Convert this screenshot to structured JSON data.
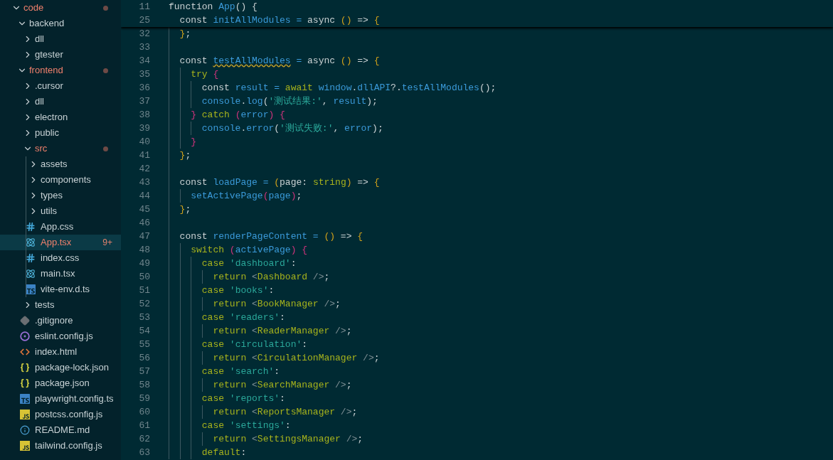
{
  "explorer": {
    "items": [
      {
        "kind": "folder",
        "name": "code",
        "expanded": true,
        "modified": true,
        "selected": false,
        "children": [
          {
            "kind": "folder",
            "name": "backend",
            "expanded": true,
            "modified": false,
            "selected": false,
            "children": [
              {
                "kind": "folder",
                "name": "dll",
                "expanded": false,
                "modified": false,
                "selected": false
              },
              {
                "kind": "folder",
                "name": "gtester",
                "expanded": false,
                "modified": false,
                "selected": false
              }
            ]
          },
          {
            "kind": "folder",
            "name": "frontend",
            "expanded": true,
            "modified": true,
            "selected": false,
            "children": [
              {
                "kind": "folder",
                "name": ".cursor",
                "expanded": false,
                "modified": false,
                "selected": false
              },
              {
                "kind": "folder",
                "name": "dll",
                "expanded": false,
                "modified": false,
                "selected": false
              },
              {
                "kind": "folder",
                "name": "electron",
                "expanded": false,
                "modified": false,
                "selected": false
              },
              {
                "kind": "folder",
                "name": "public",
                "expanded": false,
                "modified": false,
                "selected": false
              },
              {
                "kind": "folder",
                "name": "src",
                "expanded": true,
                "modified": true,
                "selected": false,
                "children": [
                  {
                    "kind": "folder",
                    "name": "assets",
                    "expanded": false,
                    "modified": false,
                    "selected": false
                  },
                  {
                    "kind": "folder",
                    "name": "components",
                    "expanded": false,
                    "modified": false,
                    "selected": false
                  },
                  {
                    "kind": "folder",
                    "name": "types",
                    "expanded": false,
                    "modified": false,
                    "selected": false
                  },
                  {
                    "kind": "folder",
                    "name": "utils",
                    "expanded": false,
                    "modified": false,
                    "selected": false
                  },
                  {
                    "kind": "css",
                    "name": "App.css",
                    "modified": false,
                    "selected": false
                  },
                  {
                    "kind": "react",
                    "name": "App.tsx",
                    "modified": true,
                    "selected": true,
                    "badge": "9+"
                  },
                  {
                    "kind": "css",
                    "name": "index.css",
                    "modified": false,
                    "selected": false
                  },
                  {
                    "kind": "react",
                    "name": "main.tsx",
                    "modified": false,
                    "selected": false
                  },
                  {
                    "kind": "ts",
                    "name": "vite-env.d.ts",
                    "modified": false,
                    "selected": false
                  }
                ]
              },
              {
                "kind": "folder",
                "name": "tests",
                "expanded": false,
                "modified": false,
                "selected": false
              },
              {
                "kind": "git",
                "name": ".gitignore",
                "modified": false,
                "selected": false
              },
              {
                "kind": "eslint",
                "name": "eslint.config.js",
                "modified": false,
                "selected": false
              },
              {
                "kind": "html",
                "name": "index.html",
                "modified": false,
                "selected": false
              },
              {
                "kind": "json",
                "name": "package-lock.json",
                "modified": false,
                "selected": false
              },
              {
                "kind": "json",
                "name": "package.json",
                "modified": false,
                "selected": false
              },
              {
                "kind": "ts",
                "name": "playwright.config.ts",
                "modified": false,
                "selected": false
              },
              {
                "kind": "js",
                "name": "postcss.config.js",
                "modified": false,
                "selected": false
              },
              {
                "kind": "info",
                "name": "README.md",
                "modified": false,
                "selected": false
              },
              {
                "kind": "js",
                "name": "tailwind.config.js",
                "modified": false,
                "selected": false
              }
            ]
          }
        ]
      }
    ]
  },
  "editor": {
    "sticky_lines": [
      {
        "number": "11",
        "tokens": [
          {
            "kind": "kw",
            "text": "function "
          },
          {
            "kind": "fn",
            "text": "App"
          },
          {
            "kind": "pl",
            "text": "() {"
          }
        ]
      },
      {
        "number": "25",
        "tokens": [
          {
            "kind": "kw",
            "text": "  const "
          },
          {
            "kind": "fn",
            "text": "initAllModules"
          },
          {
            "kind": "op",
            "text": " = "
          },
          {
            "kind": "kw",
            "text": "async "
          },
          {
            "kind": "br1",
            "text": "()"
          },
          {
            "kind": "pl",
            "text": " => "
          },
          {
            "kind": "br1",
            "text": "{"
          }
        ]
      }
    ],
    "lines": [
      {
        "number": "32",
        "tokens": [
          {
            "kind": "br1",
            "text": "  }"
          },
          {
            "kind": "pl",
            "text": ";"
          }
        ]
      },
      {
        "number": "33"
      },
      {
        "number": "34",
        "tokens": [
          {
            "kind": "kw",
            "text": "  const "
          },
          {
            "kind": "fn",
            "text": "testAllModules",
            "warning": true
          },
          {
            "kind": "op",
            "text": " = "
          },
          {
            "kind": "kw",
            "text": "async "
          },
          {
            "kind": "br1",
            "text": "()"
          },
          {
            "kind": "pl",
            "text": " => "
          },
          {
            "kind": "br1",
            "text": "{"
          }
        ]
      },
      {
        "number": "35",
        "tokens": [
          {
            "kind": "ctl",
            "text": "    try "
          },
          {
            "kind": "br2",
            "text": "{"
          }
        ]
      },
      {
        "number": "36",
        "tokens": [
          {
            "kind": "kw",
            "text": "      const "
          },
          {
            "kind": "fn",
            "text": "result"
          },
          {
            "kind": "op",
            "text": " = "
          },
          {
            "kind": "ctl",
            "text": "await "
          },
          {
            "kind": "fn",
            "text": "window"
          },
          {
            "kind": "pl",
            "text": "."
          },
          {
            "kind": "fn",
            "text": "dllAPI"
          },
          {
            "kind": "pl",
            "text": "?."
          },
          {
            "kind": "fn",
            "text": "testAllModules"
          },
          {
            "kind": "pl",
            "text": "();"
          }
        ]
      },
      {
        "number": "37",
        "tokens": [
          {
            "kind": "fn",
            "text": "      console"
          },
          {
            "kind": "pl",
            "text": "."
          },
          {
            "kind": "fn",
            "text": "log"
          },
          {
            "kind": "pl",
            "text": "("
          },
          {
            "kind": "str",
            "text": "'测试结果:'"
          },
          {
            "kind": "pl",
            "text": ", "
          },
          {
            "kind": "fn",
            "text": "result"
          },
          {
            "kind": "pl",
            "text": ");"
          }
        ]
      },
      {
        "number": "38",
        "tokens": [
          {
            "kind": "br2",
            "text": "    }"
          },
          {
            "kind": "ctl",
            "text": " catch "
          },
          {
            "kind": "br2",
            "text": "("
          },
          {
            "kind": "fn",
            "text": "error"
          },
          {
            "kind": "br2",
            "text": ") {"
          }
        ]
      },
      {
        "number": "39",
        "tokens": [
          {
            "kind": "fn",
            "text": "      console"
          },
          {
            "kind": "pl",
            "text": "."
          },
          {
            "kind": "fn",
            "text": "error"
          },
          {
            "kind": "pl",
            "text": "("
          },
          {
            "kind": "str",
            "text": "'测试失败:'"
          },
          {
            "kind": "pl",
            "text": ", "
          },
          {
            "kind": "fn",
            "text": "error"
          },
          {
            "kind": "pl",
            "text": ");"
          }
        ]
      },
      {
        "number": "40",
        "tokens": [
          {
            "kind": "br2",
            "text": "    }"
          }
        ]
      },
      {
        "number": "41",
        "tokens": [
          {
            "kind": "br1",
            "text": "  }"
          },
          {
            "kind": "pl",
            "text": ";"
          }
        ]
      },
      {
        "number": "42"
      },
      {
        "number": "43",
        "tokens": [
          {
            "kind": "kw",
            "text": "  const "
          },
          {
            "kind": "fn",
            "text": "loadPage"
          },
          {
            "kind": "op",
            "text": " = "
          },
          {
            "kind": "br1",
            "text": "("
          },
          {
            "kind": "pl",
            "text": "page: "
          },
          {
            "kind": "ctl",
            "text": "string"
          },
          {
            "kind": "br1",
            "text": ")"
          },
          {
            "kind": "pl",
            "text": " => "
          },
          {
            "kind": "br1",
            "text": "{"
          }
        ]
      },
      {
        "number": "44",
        "tokens": [
          {
            "kind": "fn",
            "text": "    setActivePage"
          },
          {
            "kind": "br2",
            "text": "("
          },
          {
            "kind": "fn",
            "text": "page"
          },
          {
            "kind": "br2",
            "text": ")"
          },
          {
            "kind": "pl",
            "text": ";"
          }
        ]
      },
      {
        "number": "45",
        "tokens": [
          {
            "kind": "br1",
            "text": "  }"
          },
          {
            "kind": "pl",
            "text": ";"
          }
        ]
      },
      {
        "number": "46"
      },
      {
        "number": "47",
        "tokens": [
          {
            "kind": "kw",
            "text": "  const "
          },
          {
            "kind": "fn",
            "text": "renderPageContent"
          },
          {
            "kind": "op",
            "text": " = "
          },
          {
            "kind": "br1",
            "text": "()"
          },
          {
            "kind": "pl",
            "text": " => "
          },
          {
            "kind": "br1",
            "text": "{"
          }
        ]
      },
      {
        "number": "48",
        "tokens": [
          {
            "kind": "ctl",
            "text": "    switch "
          },
          {
            "kind": "br2",
            "text": "("
          },
          {
            "kind": "fn",
            "text": "activePage"
          },
          {
            "kind": "br2",
            "text": ") {"
          }
        ]
      },
      {
        "number": "49",
        "tokens": [
          {
            "kind": "ctl",
            "text": "      case "
          },
          {
            "kind": "str",
            "text": "'dashboard'"
          },
          {
            "kind": "pl",
            "text": ":"
          }
        ]
      },
      {
        "number": "50",
        "tokens": [
          {
            "kind": "ctl",
            "text": "        return "
          },
          {
            "kind": "dim",
            "text": "<"
          },
          {
            "kind": "ctl",
            "text": "Dashboard"
          },
          {
            "kind": "dim",
            "text": " />"
          },
          {
            "kind": "pl",
            "text": ";"
          }
        ]
      },
      {
        "number": "51",
        "tokens": [
          {
            "kind": "ctl",
            "text": "      case "
          },
          {
            "kind": "str",
            "text": "'books'"
          },
          {
            "kind": "pl",
            "text": ":"
          }
        ]
      },
      {
        "number": "52",
        "tokens": [
          {
            "kind": "ctl",
            "text": "        return "
          },
          {
            "kind": "dim",
            "text": "<"
          },
          {
            "kind": "ctl",
            "text": "BookManager"
          },
          {
            "kind": "dim",
            "text": " />"
          },
          {
            "kind": "pl",
            "text": ";"
          }
        ]
      },
      {
        "number": "53",
        "tokens": [
          {
            "kind": "ctl",
            "text": "      case "
          },
          {
            "kind": "str",
            "text": "'readers'"
          },
          {
            "kind": "pl",
            "text": ":"
          }
        ]
      },
      {
        "number": "54",
        "tokens": [
          {
            "kind": "ctl",
            "text": "        return "
          },
          {
            "kind": "dim",
            "text": "<"
          },
          {
            "kind": "ctl",
            "text": "ReaderManager"
          },
          {
            "kind": "dim",
            "text": " />"
          },
          {
            "kind": "pl",
            "text": ";"
          }
        ]
      },
      {
        "number": "55",
        "tokens": [
          {
            "kind": "ctl",
            "text": "      case "
          },
          {
            "kind": "str",
            "text": "'circulation'"
          },
          {
            "kind": "pl",
            "text": ":"
          }
        ]
      },
      {
        "number": "56",
        "tokens": [
          {
            "kind": "ctl",
            "text": "        return "
          },
          {
            "kind": "dim",
            "text": "<"
          },
          {
            "kind": "ctl",
            "text": "CirculationManager"
          },
          {
            "kind": "dim",
            "text": " />"
          },
          {
            "kind": "pl",
            "text": ";"
          }
        ]
      },
      {
        "number": "57",
        "tokens": [
          {
            "kind": "ctl",
            "text": "      case "
          },
          {
            "kind": "str",
            "text": "'search'"
          },
          {
            "kind": "pl",
            "text": ":"
          }
        ]
      },
      {
        "number": "58",
        "tokens": [
          {
            "kind": "ctl",
            "text": "        return "
          },
          {
            "kind": "dim",
            "text": "<"
          },
          {
            "kind": "ctl",
            "text": "SearchManager"
          },
          {
            "kind": "dim",
            "text": " />"
          },
          {
            "kind": "pl",
            "text": ";"
          }
        ]
      },
      {
        "number": "59",
        "tokens": [
          {
            "kind": "ctl",
            "text": "      case "
          },
          {
            "kind": "str",
            "text": "'reports'"
          },
          {
            "kind": "pl",
            "text": ":"
          }
        ]
      },
      {
        "number": "60",
        "tokens": [
          {
            "kind": "ctl",
            "text": "        return "
          },
          {
            "kind": "dim",
            "text": "<"
          },
          {
            "kind": "ctl",
            "text": "ReportsManager"
          },
          {
            "kind": "dim",
            "text": " />"
          },
          {
            "kind": "pl",
            "text": ";"
          }
        ]
      },
      {
        "number": "61",
        "tokens": [
          {
            "kind": "ctl",
            "text": "      case "
          },
          {
            "kind": "str",
            "text": "'settings'"
          },
          {
            "kind": "pl",
            "text": ":"
          }
        ]
      },
      {
        "number": "62",
        "tokens": [
          {
            "kind": "ctl",
            "text": "        return "
          },
          {
            "kind": "dim",
            "text": "<"
          },
          {
            "kind": "ctl",
            "text": "SettingsManager"
          },
          {
            "kind": "dim",
            "text": " />"
          },
          {
            "kind": "pl",
            "text": ";"
          }
        ]
      },
      {
        "number": "63",
        "tokens": [
          {
            "kind": "ctl",
            "text": "      default"
          },
          {
            "kind": "pl",
            "text": ":"
          }
        ]
      }
    ]
  }
}
